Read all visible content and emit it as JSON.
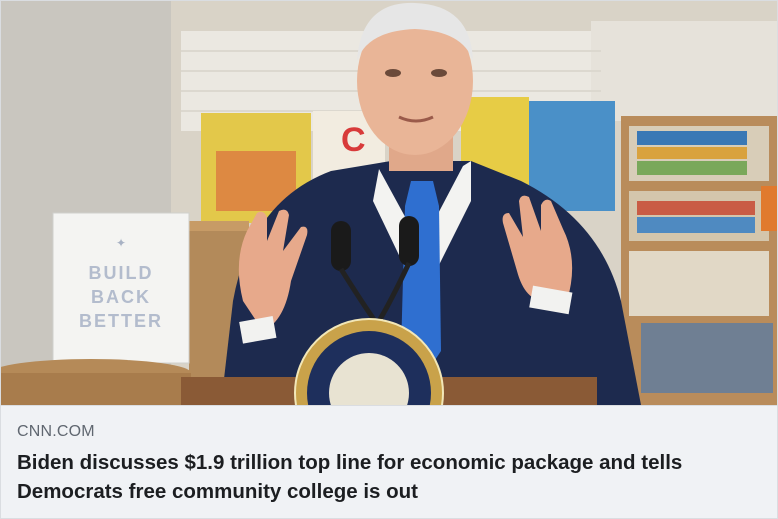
{
  "link_preview": {
    "domain": "CNN.COM",
    "headline": "Biden discusses $1.9 trillion top line for economic package and tells Democrats free community college is out"
  },
  "photo": {
    "sign_lines": [
      "BUILD",
      "BACK",
      "BETTER"
    ],
    "book_letters": "C"
  },
  "colors": {
    "card_bg": "#f0f2f5",
    "domain_text": "#606770",
    "headline_text": "#1c1e21",
    "suit": "#1d2a4e",
    "tie": "#2f6fd0"
  }
}
